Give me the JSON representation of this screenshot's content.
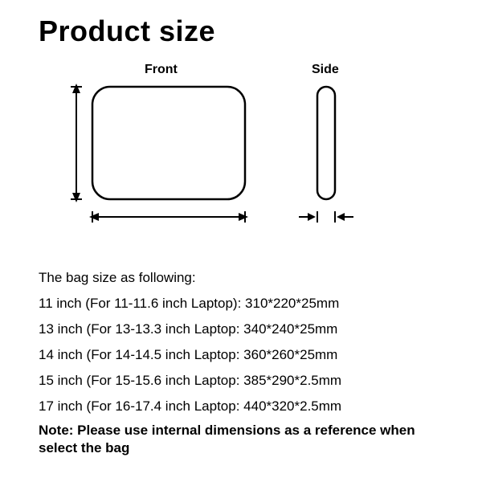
{
  "title": "Product size",
  "diagram": {
    "front_label": "Front",
    "side_label": "Side"
  },
  "sizes_header": "The bag size as following:",
  "sizes": [
    "11 inch (For 11-11.6 inch Laptop): 310*220*25mm",
    "13 inch (For 13-13.3 inch Laptop: 340*240*25mm",
    "14 inch (For 14-14.5 inch Laptop: 360*260*25mm",
    "15 inch (For 15-15.6 inch Laptop: 385*290*2.5mm",
    "17 inch (For 16-17.4 inch Laptop: 440*320*2.5mm"
  ],
  "note": "Note: Please use internal dimensions as a reference when select the bag"
}
